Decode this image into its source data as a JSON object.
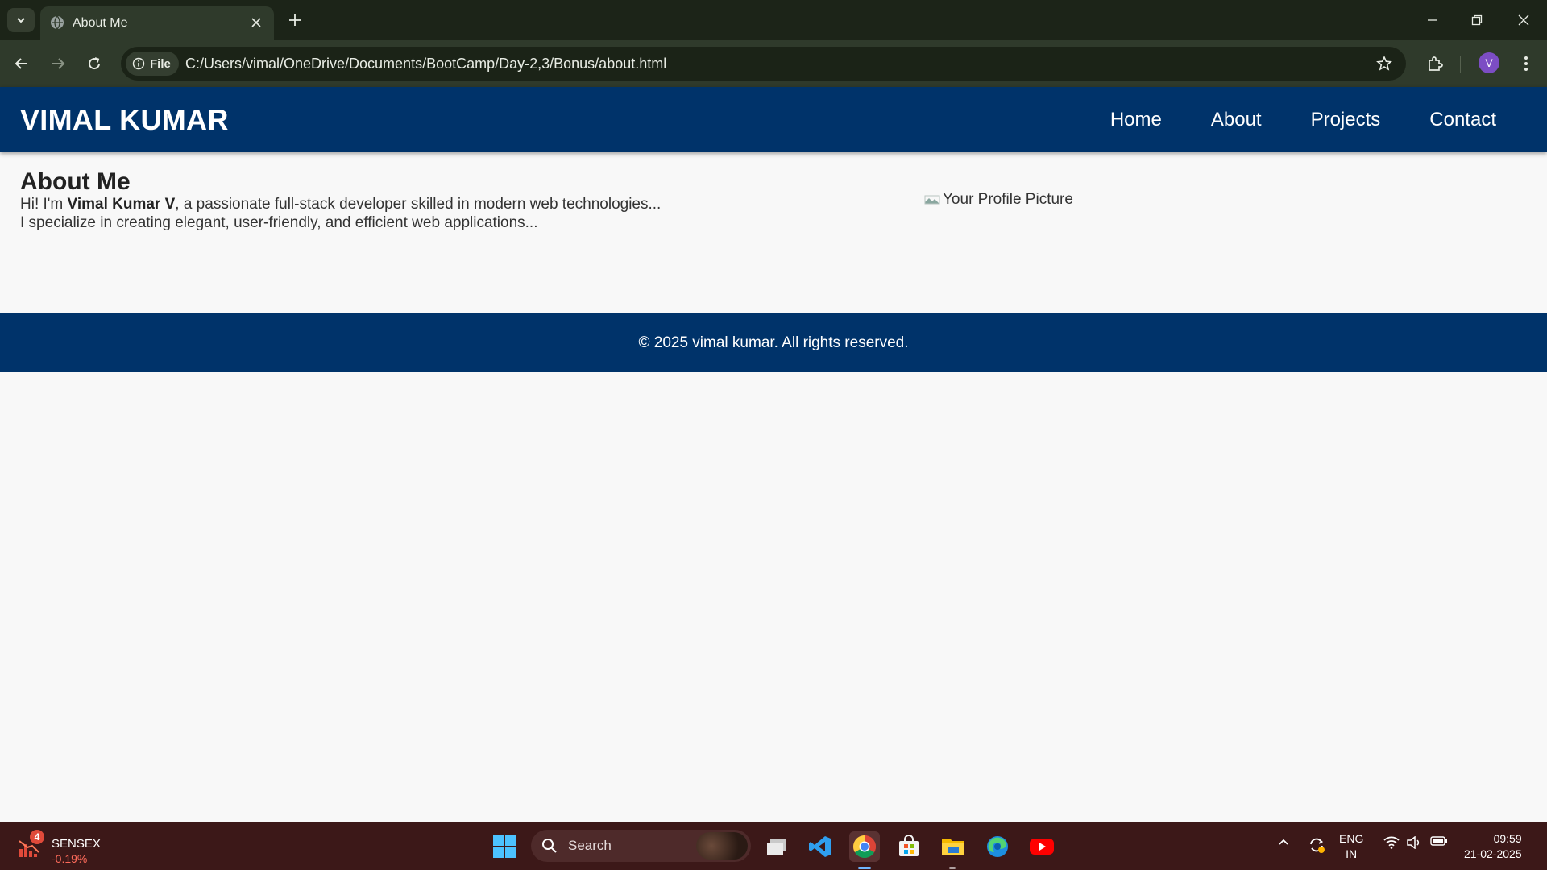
{
  "browser": {
    "tab_title": "About Me",
    "omnibox_chip": "File",
    "url": "C:/Users/vimal/OneDrive/Documents/BootCamp/Day-2,3/Bonus/about.html",
    "profile_initial": "V"
  },
  "site": {
    "brand": "VIMAL KUMAR",
    "nav": [
      "Home",
      "About",
      "Projects",
      "Contact"
    ],
    "about": {
      "title": "About Me",
      "line1_prefix": "Hi! I'm ",
      "line1_bold": "Vimal Kumar V",
      "line1_suffix": ", a passionate full-stack developer skilled in modern web technologies...",
      "line2": "I specialize in creating elegant, user-friendly, and efficient web applications...",
      "image_alt": "Your Profile Picture"
    },
    "footer": "© 2025 vimal kumar. All rights reserved."
  },
  "taskbar": {
    "widget": {
      "badge": "4",
      "title": "SENSEX",
      "value": "-0.19%"
    },
    "search_label": "Search",
    "lang_primary": "ENG",
    "lang_secondary": "IN",
    "time": "09:59",
    "date": "21-02-2025"
  },
  "colors": {
    "site_primary": "#00336a",
    "page_background": "#f8f8f8",
    "browser_frame": "#2f3a2b",
    "taskbar": "#3c1818"
  }
}
